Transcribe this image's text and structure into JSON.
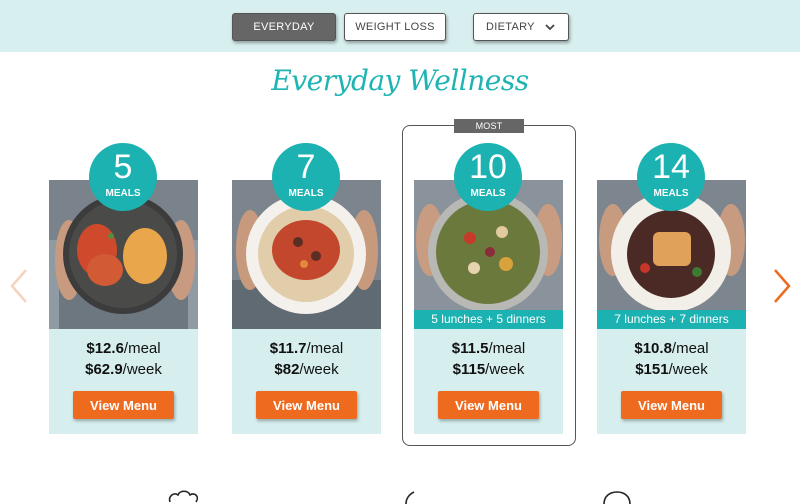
{
  "tabs": {
    "everyday": "EVERYDAY",
    "weight_loss": "WEIGHT LOSS",
    "dietary": "DIETARY"
  },
  "heading": "Everyday Wellness",
  "most_popular": "MOST POPULAR",
  "plans": [
    {
      "count": "5",
      "unit": "MEALS",
      "combo": "",
      "per_meal": "$12.6",
      "per_meal_suffix": "/meal",
      "per_week": "$62.9",
      "per_week_suffix": "/week",
      "button": "View Menu"
    },
    {
      "count": "7",
      "unit": "MEALS",
      "combo": "",
      "per_meal": "$11.7",
      "per_meal_suffix": "/meal",
      "per_week": "$82",
      "per_week_suffix": "/week",
      "button": "View Menu"
    },
    {
      "count": "10",
      "unit": "MEALS",
      "combo": "5 lunches + 5 dinners",
      "per_meal": "$11.5",
      "per_meal_suffix": "/meal",
      "per_week": "$115",
      "per_week_suffix": "/week",
      "button": "View Menu"
    },
    {
      "count": "14",
      "unit": "MEALS",
      "combo": "7 lunches + 7 dinners",
      "per_meal": "$10.8",
      "per_meal_suffix": "/meal",
      "per_week": "$151",
      "per_week_suffix": "/week",
      "button": "View Menu"
    }
  ],
  "icons": {
    "carousel_prev": "chevron-left-icon",
    "carousel_next": "chevron-right-icon",
    "dropdown": "chevron-down-icon"
  },
  "colors": {
    "teal": "#1bb2b1",
    "orange": "#ee6a1f",
    "light_teal": "#d6eeee",
    "dark_gray": "#666666"
  }
}
